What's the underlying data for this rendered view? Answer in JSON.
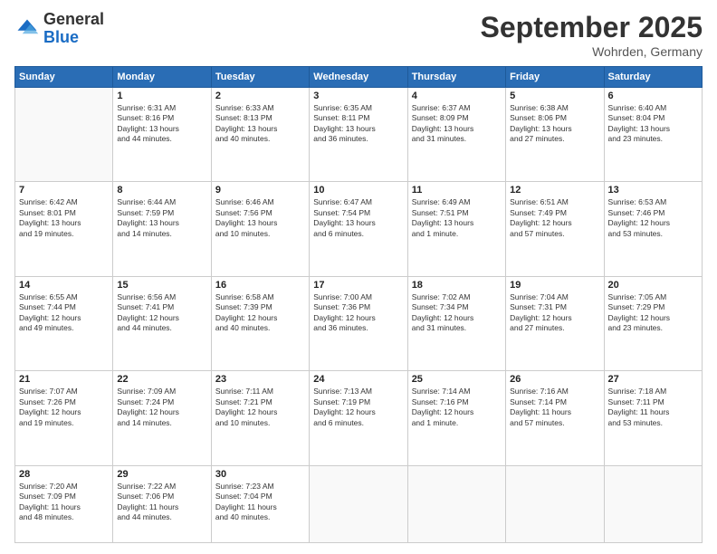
{
  "header": {
    "logo": {
      "general": "General",
      "blue": "Blue"
    },
    "title": "September 2025",
    "location": "Wohrden, Germany"
  },
  "weekdays": [
    "Sunday",
    "Monday",
    "Tuesday",
    "Wednesday",
    "Thursday",
    "Friday",
    "Saturday"
  ],
  "weeks": [
    [
      {
        "day": "",
        "content": ""
      },
      {
        "day": "1",
        "content": "Sunrise: 6:31 AM\nSunset: 8:16 PM\nDaylight: 13 hours\nand 44 minutes."
      },
      {
        "day": "2",
        "content": "Sunrise: 6:33 AM\nSunset: 8:13 PM\nDaylight: 13 hours\nand 40 minutes."
      },
      {
        "day": "3",
        "content": "Sunrise: 6:35 AM\nSunset: 8:11 PM\nDaylight: 13 hours\nand 36 minutes."
      },
      {
        "day": "4",
        "content": "Sunrise: 6:37 AM\nSunset: 8:09 PM\nDaylight: 13 hours\nand 31 minutes."
      },
      {
        "day": "5",
        "content": "Sunrise: 6:38 AM\nSunset: 8:06 PM\nDaylight: 13 hours\nand 27 minutes."
      },
      {
        "day": "6",
        "content": "Sunrise: 6:40 AM\nSunset: 8:04 PM\nDaylight: 13 hours\nand 23 minutes."
      }
    ],
    [
      {
        "day": "7",
        "content": "Sunrise: 6:42 AM\nSunset: 8:01 PM\nDaylight: 13 hours\nand 19 minutes."
      },
      {
        "day": "8",
        "content": "Sunrise: 6:44 AM\nSunset: 7:59 PM\nDaylight: 13 hours\nand 14 minutes."
      },
      {
        "day": "9",
        "content": "Sunrise: 6:46 AM\nSunset: 7:56 PM\nDaylight: 13 hours\nand 10 minutes."
      },
      {
        "day": "10",
        "content": "Sunrise: 6:47 AM\nSunset: 7:54 PM\nDaylight: 13 hours\nand 6 minutes."
      },
      {
        "day": "11",
        "content": "Sunrise: 6:49 AM\nSunset: 7:51 PM\nDaylight: 13 hours\nand 1 minute."
      },
      {
        "day": "12",
        "content": "Sunrise: 6:51 AM\nSunset: 7:49 PM\nDaylight: 12 hours\nand 57 minutes."
      },
      {
        "day": "13",
        "content": "Sunrise: 6:53 AM\nSunset: 7:46 PM\nDaylight: 12 hours\nand 53 minutes."
      }
    ],
    [
      {
        "day": "14",
        "content": "Sunrise: 6:55 AM\nSunset: 7:44 PM\nDaylight: 12 hours\nand 49 minutes."
      },
      {
        "day": "15",
        "content": "Sunrise: 6:56 AM\nSunset: 7:41 PM\nDaylight: 12 hours\nand 44 minutes."
      },
      {
        "day": "16",
        "content": "Sunrise: 6:58 AM\nSunset: 7:39 PM\nDaylight: 12 hours\nand 40 minutes."
      },
      {
        "day": "17",
        "content": "Sunrise: 7:00 AM\nSunset: 7:36 PM\nDaylight: 12 hours\nand 36 minutes."
      },
      {
        "day": "18",
        "content": "Sunrise: 7:02 AM\nSunset: 7:34 PM\nDaylight: 12 hours\nand 31 minutes."
      },
      {
        "day": "19",
        "content": "Sunrise: 7:04 AM\nSunset: 7:31 PM\nDaylight: 12 hours\nand 27 minutes."
      },
      {
        "day": "20",
        "content": "Sunrise: 7:05 AM\nSunset: 7:29 PM\nDaylight: 12 hours\nand 23 minutes."
      }
    ],
    [
      {
        "day": "21",
        "content": "Sunrise: 7:07 AM\nSunset: 7:26 PM\nDaylight: 12 hours\nand 19 minutes."
      },
      {
        "day": "22",
        "content": "Sunrise: 7:09 AM\nSunset: 7:24 PM\nDaylight: 12 hours\nand 14 minutes."
      },
      {
        "day": "23",
        "content": "Sunrise: 7:11 AM\nSunset: 7:21 PM\nDaylight: 12 hours\nand 10 minutes."
      },
      {
        "day": "24",
        "content": "Sunrise: 7:13 AM\nSunset: 7:19 PM\nDaylight: 12 hours\nand 6 minutes."
      },
      {
        "day": "25",
        "content": "Sunrise: 7:14 AM\nSunset: 7:16 PM\nDaylight: 12 hours\nand 1 minute."
      },
      {
        "day": "26",
        "content": "Sunrise: 7:16 AM\nSunset: 7:14 PM\nDaylight: 11 hours\nand 57 minutes."
      },
      {
        "day": "27",
        "content": "Sunrise: 7:18 AM\nSunset: 7:11 PM\nDaylight: 11 hours\nand 53 minutes."
      }
    ],
    [
      {
        "day": "28",
        "content": "Sunrise: 7:20 AM\nSunset: 7:09 PM\nDaylight: 11 hours\nand 48 minutes."
      },
      {
        "day": "29",
        "content": "Sunrise: 7:22 AM\nSunset: 7:06 PM\nDaylight: 11 hours\nand 44 minutes."
      },
      {
        "day": "30",
        "content": "Sunrise: 7:23 AM\nSunset: 7:04 PM\nDaylight: 11 hours\nand 40 minutes."
      },
      {
        "day": "",
        "content": ""
      },
      {
        "day": "",
        "content": ""
      },
      {
        "day": "",
        "content": ""
      },
      {
        "day": "",
        "content": ""
      }
    ]
  ]
}
